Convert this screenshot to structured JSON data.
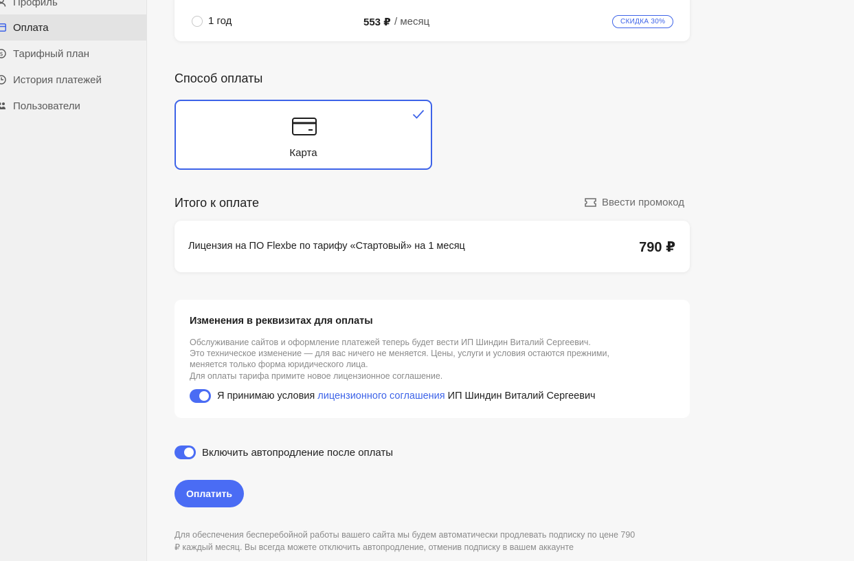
{
  "sidebar": {
    "items": [
      {
        "label": "Профиль",
        "icon": "user-icon"
      },
      {
        "label": "Оплата",
        "icon": "card-icon",
        "active": true
      },
      {
        "label": "Тарифный план",
        "icon": "coin-icon"
      },
      {
        "label": "История платежей",
        "icon": "history-icon"
      },
      {
        "label": "Пользователи",
        "icon": "users-icon"
      }
    ]
  },
  "period": {
    "label": "1 год",
    "price": "553 ₽",
    "unit": "/ месяц",
    "badge": "СКИДКА 30%"
  },
  "payment_method": {
    "title": "Способ оплаты",
    "option_label": "Карта",
    "selected": true
  },
  "total": {
    "title": "Итого к оплате",
    "promo_label": "Ввести промокод",
    "license_text": "Лицензия на ПО Flexbe по тарифу «Стартовый» на 1 месяц",
    "price": "790 ₽"
  },
  "notice": {
    "title": "Изменения в реквизитах для оплаты",
    "lines": [
      "Обслуживание сайтов и оформление платежей теперь будет вести ИП Шиндин Виталий Сергеевич.",
      "Это техническое изменение — для вас ничего не меняется. Цены, услуги и условия остаются прежними,",
      "меняется только форма юридического лица.",
      "Для оплаты тарифа примите новое лицензионное соглашение."
    ],
    "agree_prefix": "Я принимаю условия",
    "agree_link": "лицензионного соглашения",
    "agree_suffix": "ИП Шиндин Виталий Сергеевич",
    "agree_checked": true
  },
  "autorenew": {
    "label": "Включить автопродление после оплаты",
    "enabled": true
  },
  "pay_button": "Оплатить",
  "footnote": [
    "Для обеспечения бесперебойной работы вашего сайта мы будем автоматически продлевать подписку по цене 790",
    "₽ каждый месяц. Вы всегда можете отключить автопродление, отменив подписку в вашем аккаунте"
  ],
  "colors": {
    "accent": "#4a6cf4",
    "link": "#3d63e8",
    "muted_text": "#8a8a8a",
    "background": "#f7f7f7"
  }
}
